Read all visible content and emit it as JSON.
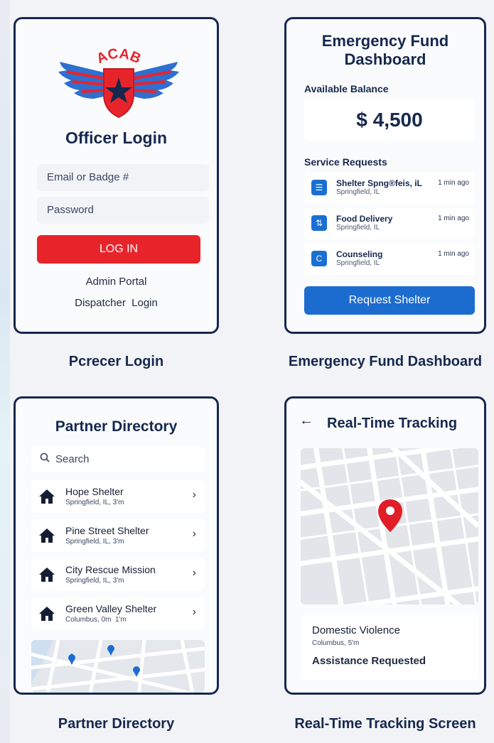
{
  "login": {
    "logo_text": "ACAB",
    "title": "Officer Login",
    "email_placeholder": "Email or Badge #",
    "password_placeholder": "Password",
    "login_button": "LOG IN",
    "admin_link": "Admin Portal",
    "dispatcher_link": "Dispatcher  Login",
    "caption": "Pcrecer Login"
  },
  "dashboard": {
    "title_line1": "Emergency Fund",
    "title_line2": "Dashboard",
    "balance_label": "Available Balance",
    "balance": "$ 4,500",
    "requests_label": "Service Requests",
    "requests": [
      {
        "name": "Shelter Spng®feis, iL",
        "location": "Springfield, IL",
        "time": "1 min ago",
        "icon": "list-icon"
      },
      {
        "name": "Food Delivery",
        "location": "Springfield, IL",
        "time": "1 min ago",
        "icon": "delivery-icon"
      },
      {
        "name": "Counseling",
        "location": "Springfield, IL",
        "time": "1 min ago",
        "icon": "chat-icon"
      }
    ],
    "request_button": "Request Shelter",
    "caption": "Emergency Fund Dashboard",
    "accent_color": "#1c6ccf"
  },
  "directory": {
    "title": "Partner Directory",
    "search_placeholder": "Search",
    "partners": [
      {
        "name": "Hope Shelter",
        "location": "Springfield, IL, 3'm"
      },
      {
        "name": "Pine Street Shelter",
        "location": "Springfield, IL, 3'm"
      },
      {
        "name": "City Rescue Mission",
        "location": "Springfield, IL, 3'm"
      },
      {
        "name": "Green Valley Shelter",
        "location": "Columbus, 0m  1'm"
      }
    ],
    "caption": "Partner Directory"
  },
  "tracking": {
    "title": "Real-Time Tracking",
    "incident_title": "Domestic Violence",
    "incident_location": "Columbus, 5'm",
    "status": "Assistance Requested",
    "caption": "Real-Time Tracking Screen",
    "pin_color": "#e01e28"
  }
}
